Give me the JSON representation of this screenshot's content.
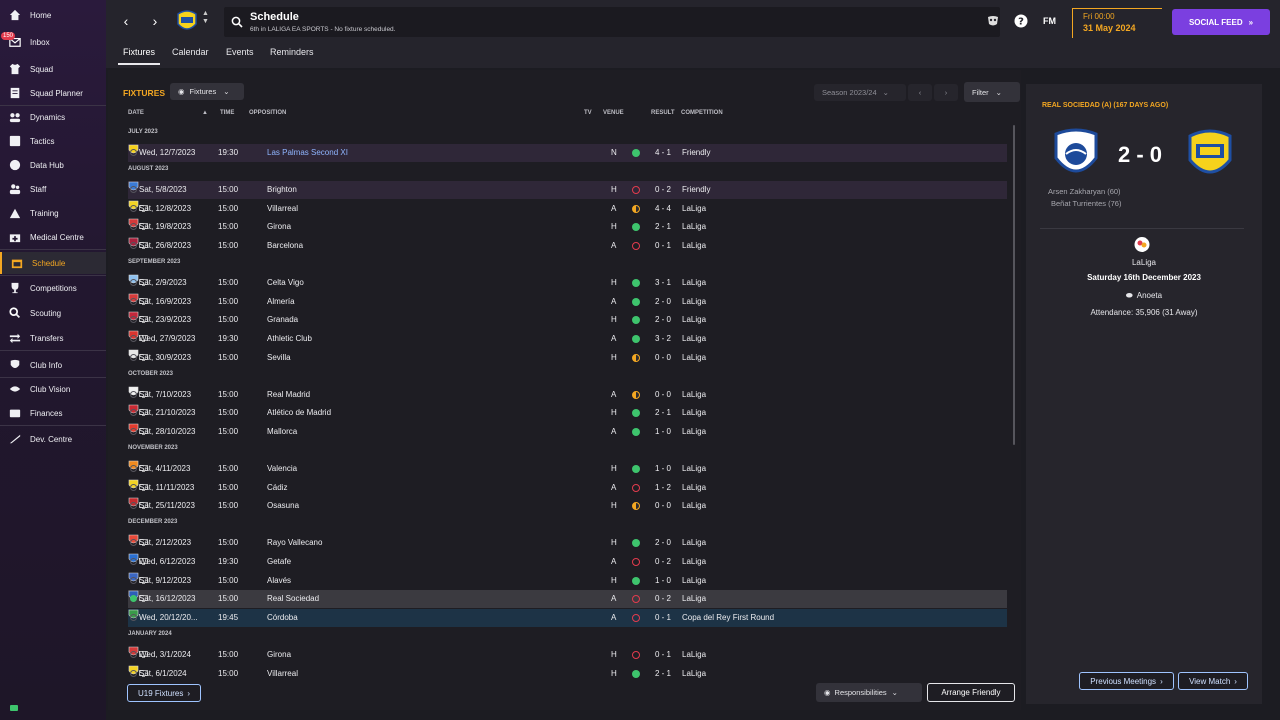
{
  "sidebar": {
    "items": [
      {
        "label": "Home",
        "icon": "home-icon"
      },
      {
        "label": "Inbox",
        "icon": "inbox-icon",
        "badge": "150"
      },
      {
        "label": "Squad",
        "icon": "shirt-icon"
      },
      {
        "label": "Squad Planner",
        "icon": "planner-icon"
      },
      {
        "label": "Dynamics",
        "icon": "dynamics-icon"
      },
      {
        "label": "Tactics",
        "icon": "tactics-icon"
      },
      {
        "label": "Data Hub",
        "icon": "data-hub-icon"
      },
      {
        "label": "Staff",
        "icon": "staff-icon"
      },
      {
        "label": "Training",
        "icon": "training-icon"
      },
      {
        "label": "Medical Centre",
        "icon": "medical-icon"
      },
      {
        "label": "Schedule",
        "icon": "calendar-icon"
      },
      {
        "label": "Competitions",
        "icon": "trophy-icon"
      },
      {
        "label": "Scouting",
        "icon": "scouting-icon"
      },
      {
        "label": "Transfers",
        "icon": "transfers-icon"
      },
      {
        "label": "Club Info",
        "icon": "shield-icon"
      },
      {
        "label": "Club Vision",
        "icon": "vision-icon"
      },
      {
        "label": "Finances",
        "icon": "finances-icon"
      },
      {
        "label": "Dev. Centre",
        "icon": "dev-centre-icon"
      }
    ],
    "active": "Schedule"
  },
  "header": {
    "title": "Schedule",
    "subtitle": "6th in LALIGA EA SPORTS - No fixture scheduled.",
    "fm_logo": "FM",
    "time": "Fri 00:00",
    "date": "31 May 2024",
    "social_feed": "SOCIAL FEED",
    "accent_color": "#f3a722",
    "social_color": "#7b3fe0"
  },
  "tabs": [
    "Fixtures",
    "Calendar",
    "Events",
    "Reminders"
  ],
  "fixtures": {
    "title": "FIXTURES",
    "view_dropdown": "Fixtures",
    "season_dropdown": "Season 2023/24",
    "filter_label": "Filter",
    "columns": {
      "date": "DATE",
      "time": "TIME",
      "opposition": "OPPOSITION",
      "tv": "TV",
      "venue": "VENUE",
      "result": "RESULT",
      "competition": "COMPETITION"
    },
    "months": [
      "JULY 2023",
      "AUGUST 2023",
      "SEPTEMBER 2023",
      "OCTOBER 2023",
      "NOVEMBER 2023",
      "DECEMBER 2023",
      "JANUARY 2024"
    ],
    "rows": [
      {
        "date": "Wed, 12/7/2023",
        "time": "19:30",
        "opp": "Las Palmas Second XI",
        "tv": false,
        "venue": "N",
        "res": "win",
        "score": "4 - 1",
        "comp": "Friendly"
      },
      {
        "date": "Sat, 5/8/2023",
        "time": "15:00",
        "opp": "Brighton",
        "tv": false,
        "venue": "H",
        "res": "loss",
        "score": "0 - 2",
        "comp": "Friendly"
      },
      {
        "date": "Sat, 12/8/2023",
        "time": "15:00",
        "opp": "Villarreal",
        "tv": true,
        "venue": "A",
        "res": "draw",
        "score": "4 - 4",
        "comp": "LaLiga"
      },
      {
        "date": "Sat, 19/8/2023",
        "time": "15:00",
        "opp": "Girona",
        "tv": true,
        "venue": "H",
        "res": "win",
        "score": "2 - 1",
        "comp": "LaLiga"
      },
      {
        "date": "Sat, 26/8/2023",
        "time": "15:00",
        "opp": "Barcelona",
        "tv": true,
        "venue": "A",
        "res": "loss",
        "score": "0 - 1",
        "comp": "LaLiga"
      },
      {
        "date": "Sat, 2/9/2023",
        "time": "15:00",
        "opp": "Celta Vigo",
        "tv": true,
        "venue": "H",
        "res": "win",
        "score": "3 - 1",
        "comp": "LaLiga"
      },
      {
        "date": "Sat, 16/9/2023",
        "time": "15:00",
        "opp": "Almería",
        "tv": true,
        "venue": "A",
        "res": "win",
        "score": "2 - 0",
        "comp": "LaLiga"
      },
      {
        "date": "Sat, 23/9/2023",
        "time": "15:00",
        "opp": "Granada",
        "tv": true,
        "venue": "H",
        "res": "win",
        "score": "2 - 0",
        "comp": "LaLiga"
      },
      {
        "date": "Wed, 27/9/2023",
        "time": "19:30",
        "opp": "Athletic Club",
        "tv": true,
        "venue": "A",
        "res": "win",
        "score": "3 - 2",
        "comp": "LaLiga"
      },
      {
        "date": "Sat, 30/9/2023",
        "time": "15:00",
        "opp": "Sevilla",
        "tv": true,
        "venue": "H",
        "res": "draw",
        "score": "0 - 0",
        "comp": "LaLiga"
      },
      {
        "date": "Sat, 7/10/2023",
        "time": "15:00",
        "opp": "Real Madrid",
        "tv": true,
        "venue": "A",
        "res": "draw",
        "score": "0 - 0",
        "comp": "LaLiga"
      },
      {
        "date": "Sat, 21/10/2023",
        "time": "15:00",
        "opp": "Atlético de Madrid",
        "tv": true,
        "venue": "H",
        "res": "win",
        "score": "2 - 1",
        "comp": "LaLiga"
      },
      {
        "date": "Sat, 28/10/2023",
        "time": "15:00",
        "opp": "Mallorca",
        "tv": true,
        "venue": "A",
        "res": "win",
        "score": "1 - 0",
        "comp": "LaLiga"
      },
      {
        "date": "Sat, 4/11/2023",
        "time": "15:00",
        "opp": "Valencia",
        "tv": true,
        "venue": "H",
        "res": "win",
        "score": "1 - 0",
        "comp": "LaLiga"
      },
      {
        "date": "Sat, 11/11/2023",
        "time": "15:00",
        "opp": "Cádiz",
        "tv": true,
        "venue": "A",
        "res": "loss",
        "score": "1 - 2",
        "comp": "LaLiga"
      },
      {
        "date": "Sat, 25/11/2023",
        "time": "15:00",
        "opp": "Osasuna",
        "tv": true,
        "venue": "H",
        "res": "draw",
        "score": "0 - 0",
        "comp": "LaLiga"
      },
      {
        "date": "Sat, 2/12/2023",
        "time": "15:00",
        "opp": "Rayo Vallecano",
        "tv": true,
        "venue": "H",
        "res": "win",
        "score": "2 - 0",
        "comp": "LaLiga"
      },
      {
        "date": "Wed, 6/12/2023",
        "time": "19:30",
        "opp": "Getafe",
        "tv": true,
        "venue": "A",
        "res": "loss",
        "score": "0 - 2",
        "comp": "LaLiga"
      },
      {
        "date": "Sat, 9/12/2023",
        "time": "15:00",
        "opp": "Alavés",
        "tv": true,
        "venue": "H",
        "res": "win",
        "score": "1 - 0",
        "comp": "LaLiga"
      },
      {
        "date": "Sat, 16/12/2023",
        "time": "15:00",
        "opp": "Real Sociedad",
        "tv": true,
        "venue": "A",
        "res": "loss",
        "score": "0 - 2",
        "comp": "LaLiga"
      },
      {
        "date": "Wed, 20/12/20...",
        "time": "19:45",
        "opp": "Córdoba",
        "tv": false,
        "venue": "A",
        "res": "loss",
        "score": "0 - 1",
        "comp": "Copa del Rey First Round"
      },
      {
        "date": "Wed, 3/1/2024",
        "time": "15:00",
        "opp": "Girona",
        "tv": true,
        "venue": "H",
        "res": "loss",
        "score": "0 - 1",
        "comp": "LaLiga"
      },
      {
        "date": "Sat, 6/1/2024",
        "time": "15:00",
        "opp": "Villarreal",
        "tv": true,
        "venue": "H",
        "res": "win",
        "score": "2 - 1",
        "comp": "LaLiga"
      }
    ],
    "u19_button": "U19 Fixtures",
    "responsibilities_button": "Responsibilities",
    "arrange_friendly_button": "Arrange Friendly"
  },
  "match_panel": {
    "title": "REAL SOCIEDAD (A) (167 DAYS AGO)",
    "score": "2 - 0",
    "scorers": [
      "Arsen Zakharyan (60)",
      "Beñat Turrientes (76)"
    ],
    "competition": "LaLiga",
    "date": "Saturday 16th December 2023",
    "stadium": "Anoeta",
    "attendance": "Attendance: 35,906 (31 Away)",
    "previous_meetings_button": "Previous Meetings",
    "view_match_button": "View Match"
  }
}
